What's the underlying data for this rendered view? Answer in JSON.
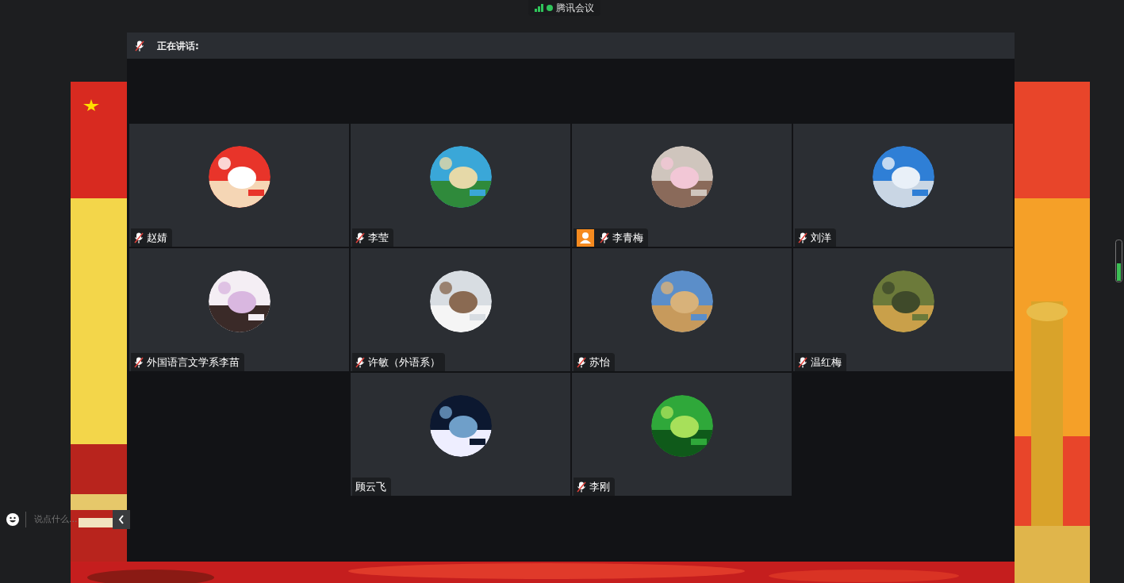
{
  "app": {
    "title": "腾讯会议"
  },
  "speaking": {
    "label": "正在讲话:"
  },
  "tiles": [
    {
      "kind": "participant",
      "name": "赵婧",
      "muted": true,
      "host": false
    },
    {
      "kind": "participant",
      "name": "李莹",
      "muted": true,
      "host": false
    },
    {
      "kind": "participant",
      "name": "李青梅",
      "muted": true,
      "host": true
    },
    {
      "kind": "participant",
      "name": "刘洋",
      "muted": true,
      "host": false
    },
    {
      "kind": "participant",
      "name": "外国语言文学系李苗",
      "muted": true,
      "host": false
    },
    {
      "kind": "participant",
      "name": "许敏（外语系）",
      "muted": true,
      "host": false
    },
    {
      "kind": "participant",
      "name": "苏怡",
      "muted": true,
      "host": false
    },
    {
      "kind": "participant",
      "name": "温红梅",
      "muted": true,
      "host": false
    },
    {
      "kind": "empty"
    },
    {
      "kind": "participant",
      "name": "顾云飞",
      "muted": false,
      "host": false
    },
    {
      "kind": "participant",
      "name": "李刚",
      "muted": true,
      "host": false
    },
    {
      "kind": "empty"
    }
  ],
  "chat": {
    "placeholder": "说点什么..."
  }
}
